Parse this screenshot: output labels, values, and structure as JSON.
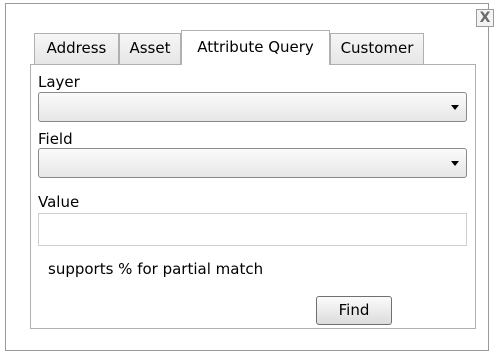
{
  "dialog": {
    "close_label": "X"
  },
  "tabs": [
    {
      "label": "Address",
      "active": false
    },
    {
      "label": "Asset",
      "active": false
    },
    {
      "label": "Attribute Query",
      "active": true
    },
    {
      "label": "Customer",
      "active": false
    }
  ],
  "form": {
    "layer_label": "Layer",
    "layer_value": "",
    "field_label": "Field",
    "field_value": "",
    "value_label": "Value",
    "value_value": "",
    "hint": "supports % for partial match",
    "find_label": "Find"
  }
}
